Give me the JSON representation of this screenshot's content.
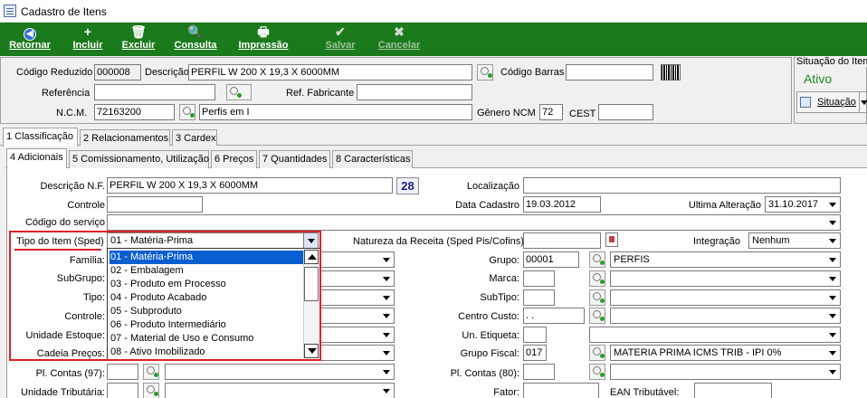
{
  "window": {
    "title": "Cadastro de Itens"
  },
  "toolbar": {
    "retornar": "Retornar",
    "incluir": "Incluir",
    "excluir": "Excluir",
    "consulta": "Consulta",
    "impressao": "Impressão",
    "salvar": "Salvar",
    "cancelar": "Cancelar"
  },
  "header": {
    "codigo_reduzido_label": "Código Reduzido",
    "codigo_reduzido": "000008",
    "descricao_label": "Descrição",
    "descricao": "PERFIL W 200 X 19,3 X 6000MM",
    "codigo_barras_label": "Código Barras",
    "codigo_barras": "",
    "referencia_label": "Referência",
    "referencia": "",
    "ref_fabricante_label": "Ref. Fabricante",
    "ref_fabricante": "",
    "ncm_label": "N.C.M.",
    "ncm": "72163200",
    "ncm_desc": "Perfis em I",
    "genero_ncm_label": "Gênero NCM",
    "genero_ncm": "72",
    "cest_label": "CEST",
    "cest": ""
  },
  "situacao": {
    "title": "Situação do Item",
    "status": "Ativo",
    "button": "Situação",
    "status_color": "#1f8a1f"
  },
  "tabs_main": [
    "1 Classificação",
    "2 Relacionamentos",
    "3 Cardex"
  ],
  "tabs_sub": [
    "4 Adicionais",
    "5 Comissionamento, Utilização",
    "6 Preços",
    "7 Quantidades",
    "8 Características"
  ],
  "form": {
    "descricao_nf_label": "Descrição N.F.",
    "descricao_nf": "PERFIL W 200 X 19,3 X 6000MM",
    "descricao_nf_count": "28",
    "localizacao_label": "Localização",
    "localizacao": "",
    "controle_label": "Controle",
    "data_cadastro_label": "Data Cadastro",
    "data_cadastro": "19.03.2012",
    "ultima_alteracao_label": "Ultima Alteração",
    "ultima_alteracao": "31.10.2017",
    "codigo_servico_label": "Código do serviço",
    "tipo_item_label": "Tipo do Item (Sped)",
    "tipo_item": "01 - Matéria-Prima",
    "natureza_label": "Natureza da Receita (Sped Pis/Cofins)",
    "natureza": "",
    "integracao_label": "Integração",
    "integracao": "Nenhum",
    "familia_label": "Família:",
    "subgrupo_label": "SubGrupo:",
    "tipo_label": "Tipo:",
    "controle2_label": "Controle:",
    "unidade_estoque_label": "Unidade Estoque:",
    "cadeia_precos_label": "Cadeia Preços:",
    "pl_contas97_label": "Pl. Contas (97):",
    "unidade_tributaria_label": "Unidade Tributária:",
    "grupo_label": "Grupo:",
    "grupo_code": "00001",
    "grupo_desc": "PERFIS",
    "marca_label": "Marca:",
    "subtipo_label": "SubTipo:",
    "centro_custo_label": "Centro Custo:",
    "centro_custo": " .  .",
    "un_etiqueta_label": "Un. Etiqueta:",
    "grupo_fiscal_label": "Grupo Fiscal:",
    "grupo_fiscal_code": "017",
    "grupo_fiscal_desc": "MATERIA PRIMA ICMS TRIB - IPI 0%",
    "pl_contas80_label": "Pl. Contas (80):",
    "fator_label": "Fator:",
    "ean_label": "EAN Tributável:",
    "ean": ""
  },
  "dropdown_options": [
    "01 - Matéria-Prima",
    "02 - Embalagem",
    "03 - Produto em Processo",
    "04 - Produto Acabado",
    "05 - Subproduto",
    "06 - Produto Intermediário",
    "07 - Material de Uso e Consumo",
    "08 - Ativo Imobilizado"
  ],
  "colors": {
    "toolbar_bg": "#1b7a1b",
    "highlight": "#e0202a",
    "selection": "#0a5fd0"
  }
}
